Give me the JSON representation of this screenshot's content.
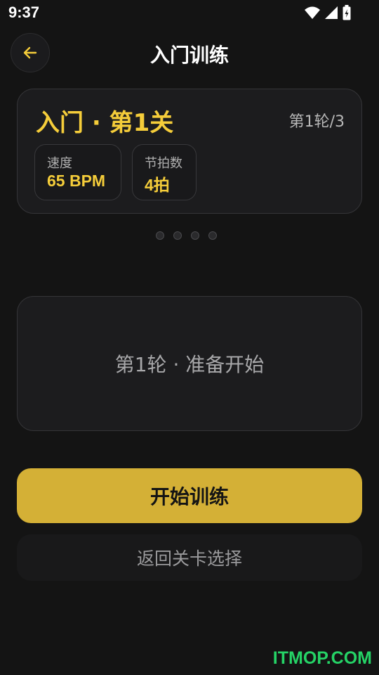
{
  "status_bar": {
    "time": "9:37",
    "icons": [
      "wifi-icon",
      "signal-icon",
      "battery-icon"
    ]
  },
  "header": {
    "back_icon": "arrow-left-icon",
    "title": "入门训练"
  },
  "level_card": {
    "title": "入门 · 第1关",
    "round_counter": "第1轮/3",
    "stats": [
      {
        "label": "速度",
        "value": "65 BPM"
      },
      {
        "label": "节拍数",
        "value": "4拍"
      }
    ]
  },
  "pager": {
    "count": 4,
    "active_index": null
  },
  "status_panel": {
    "text": "第1轮 · 准备开始"
  },
  "actions": {
    "start_label": "开始训练",
    "back_label": "返回关卡选择"
  },
  "watermark": "ITMOP.COM",
  "colors": {
    "accent": "#f5cd3a",
    "button": "#d4b036",
    "background": "#141414",
    "card": "#1c1c1e"
  }
}
